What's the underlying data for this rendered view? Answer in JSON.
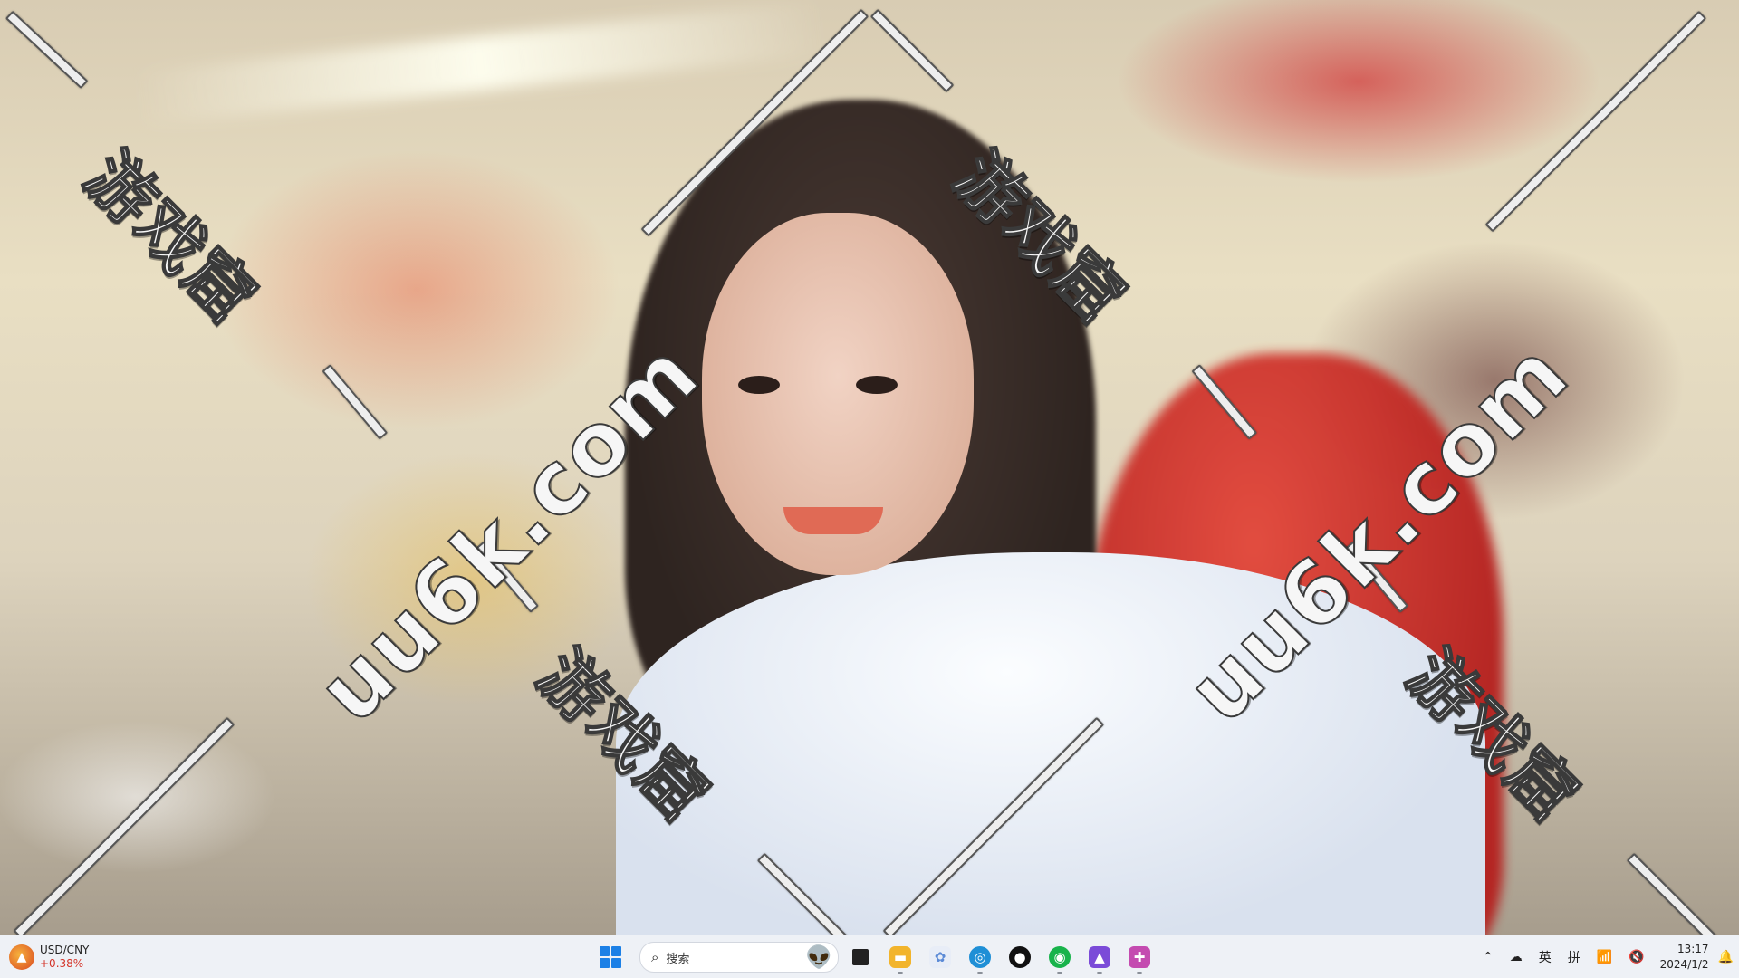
{
  "wallpaper": {
    "description_icon": "photo-wallpaper"
  },
  "watermark": {
    "cn_text": "游戏窟",
    "url_text": "uu6k.com"
  },
  "taskbar": {
    "widget": {
      "pair": "USD/CNY",
      "change": "+0.38%",
      "icon": "stock-widget-icon",
      "change_color": "#d4352a"
    },
    "search": {
      "placeholder": "搜索"
    },
    "apps": [
      {
        "name": "file-explorer-icon",
        "color": "#f2b42c"
      },
      {
        "name": "browser-app-icon",
        "color": "#5b8ad6"
      },
      {
        "name": "edge-browser-icon",
        "color": "#1f8fd6"
      },
      {
        "name": "qq-icon",
        "color": "#111111"
      },
      {
        "name": "wechat-icon",
        "color": "#18b34b"
      },
      {
        "name": "photos-app-icon",
        "color": "#7b4bd8"
      },
      {
        "name": "puzzle-app-icon",
        "color": "#c44bb0"
      }
    ],
    "tray": {
      "ime_lang": "英",
      "ime_mode": "拼",
      "time": "13:17",
      "date": "2024/1/2"
    },
    "accent_color": "#1c80e6"
  }
}
